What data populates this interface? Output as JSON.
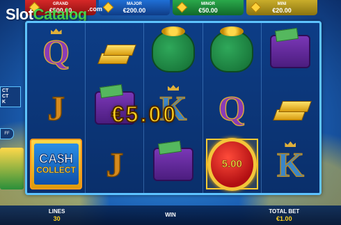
{
  "watermark": {
    "brand_a": "Slot",
    "brand_b": "Catalog",
    "suffix": ".com"
  },
  "jackpots": [
    {
      "label": "GRAND",
      "value": "€500.00",
      "icon": "gem-icon",
      "color": "#d62828"
    },
    {
      "label": "MAJOR",
      "value": "€200.00",
      "icon": "gem-icon",
      "color": "#1f6fd6"
    },
    {
      "label": "MINOR",
      "value": "€50.00",
      "icon": "gem-icon",
      "color": "#2aa84a"
    },
    {
      "label": "MINI",
      "value": "€20.00",
      "icon": "gem-icon",
      "color": "#c9ad2b"
    }
  ],
  "reels": [
    [
      "Q",
      "J",
      "CASH COLLECT"
    ],
    [
      "gold-bars",
      "wallet",
      "J"
    ],
    [
      "money-bag",
      "K",
      "wallet"
    ],
    [
      "money-bag",
      "Q",
      "5.00 coin"
    ],
    [
      "wallet",
      "gold-bars",
      "K"
    ]
  ],
  "cash_collect": {
    "line1": "CA$H",
    "line2": "COLLECT"
  },
  "coin_value": "5.00",
  "win_amount": "€5.00",
  "side": {
    "badge": "CT\nCT\nK",
    "round_button": "FF"
  },
  "bottom": {
    "lines_label": "LINES",
    "lines_value": "30",
    "win_label": "WIN",
    "win_value": "",
    "bet_label": "TOTAL BET",
    "bet_value": "€1.00"
  }
}
